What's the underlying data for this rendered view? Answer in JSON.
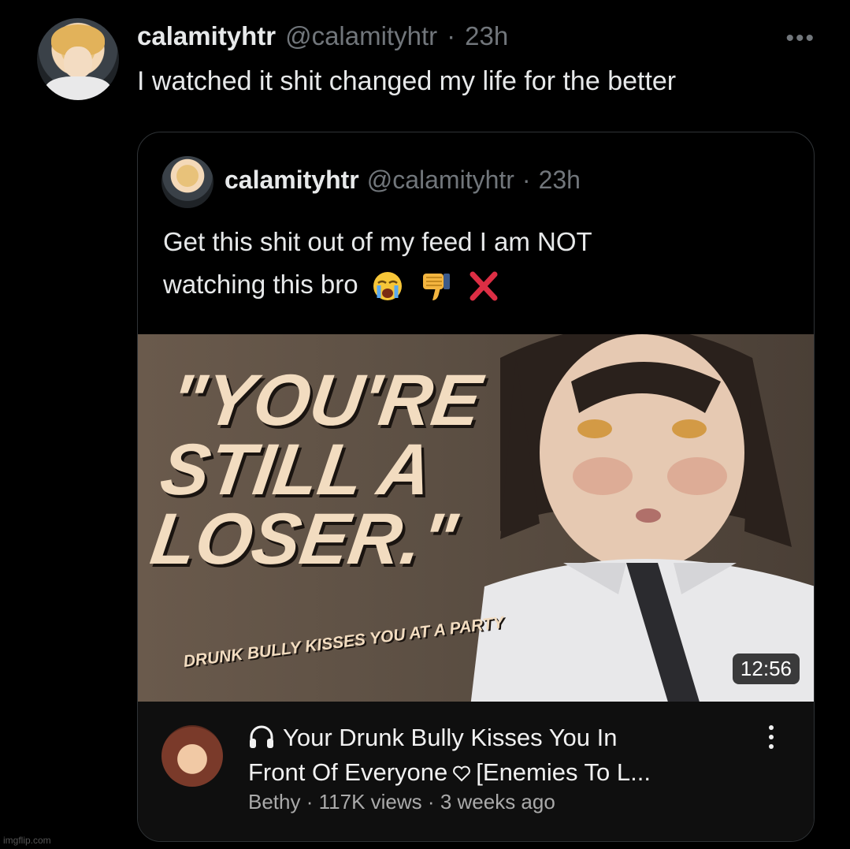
{
  "tweet": {
    "display_name": "calamityhtr",
    "handle": "@calamityhtr",
    "separator": "·",
    "time": "23h",
    "more_label": "•••",
    "text": "I watched it shit changed my life for the better"
  },
  "quoted_tweet": {
    "display_name": "calamityhtr",
    "handle": "@calamityhtr",
    "separator": "·",
    "time": "23h",
    "text_line1": "Get this shit out of my feed I am NOT",
    "text_line2": "watching this bro",
    "emojis": [
      "loudly-crying-face",
      "thumbs-down",
      "cross-mark"
    ]
  },
  "video": {
    "thumbnail_title_lines": [
      "\"YOU'RE",
      "STILL A",
      "LOSER.\""
    ],
    "thumbnail_subtitle": "DRUNK BULLY KISSES YOU AT A PARTY",
    "duration": "12:56",
    "title_line1": "Your Drunk Bully Kisses You In",
    "title_line2_a": "Front Of Everyone",
    "title_line2_b": "[Enemies To L...",
    "channel": "Bethy",
    "views": "117K views",
    "age": "3 weeks ago",
    "meta_separator": "·"
  },
  "watermark": "imgflip.com",
  "colors": {
    "background": "#000000",
    "primary_text": "#e7e9ea",
    "secondary_text": "#71767b",
    "card_border": "#2f3336",
    "video_meta_bg": "#0f0f0f"
  }
}
